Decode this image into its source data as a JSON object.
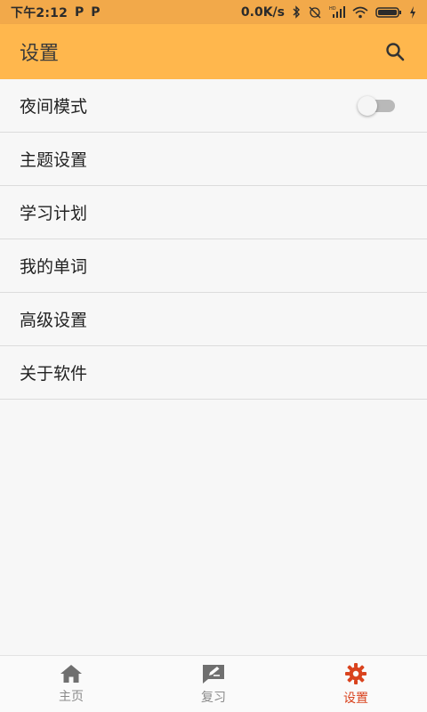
{
  "status_bar": {
    "time": "下午2:12",
    "p_icon_1": "P",
    "p_icon_2": "P",
    "net_speed": "0.0K/s",
    "icons": [
      "bluetooth-icon",
      "alarm-off-icon",
      "hd-signal-icon",
      "wifi-icon",
      "battery-icon",
      "charging-icon"
    ]
  },
  "app_bar": {
    "title": "设置",
    "search_icon": "search-icon",
    "background": "#ffb74d"
  },
  "settings": {
    "items": [
      {
        "label": "夜间模式",
        "toggle": true,
        "toggle_on": false
      },
      {
        "label": "主题设置"
      },
      {
        "label": "学习计划"
      },
      {
        "label": "我的单词"
      },
      {
        "label": "高级设置"
      },
      {
        "label": "关于软件"
      }
    ]
  },
  "bottom_nav": {
    "items": [
      {
        "label": "主页",
        "icon": "home-icon",
        "active": false
      },
      {
        "label": "复习",
        "icon": "review-icon",
        "active": false
      },
      {
        "label": "设置",
        "icon": "gear-icon",
        "active": true
      }
    ],
    "active_color": "#d9431e",
    "inactive_color": "#8a8a8a"
  }
}
